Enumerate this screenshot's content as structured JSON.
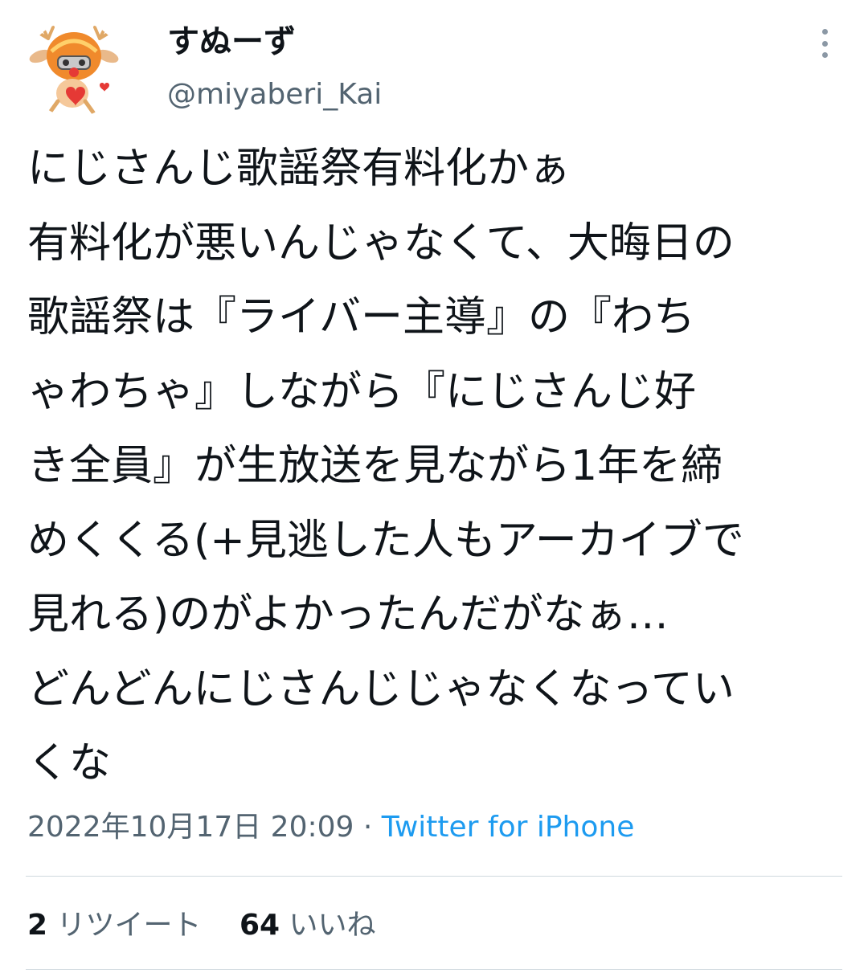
{
  "user": {
    "display_name": "すぬーず",
    "handle": "@miyaberi_Kai",
    "avatar_icon": "deer-character-avatar-icon"
  },
  "menu": {
    "icon": "more-vertical-icon"
  },
  "tweet": {
    "lines": [
      "にじさんじ歌謡祭有料化かぁ",
      "有料化が悪いんじゃなくて、大晦日の",
      "歌謡祭は『ライバー主導』の『わち",
      "ゃわちゃ』しながら『にじさんじ好",
      "き全員』が生放送を見ながら1年を締",
      "めくくる(+見逃した人もアーカイブで",
      "見れる)のがよかったんだがなぁ…",
      "どんどんにじさんじじゃなくなってい",
      "くな"
    ]
  },
  "meta": {
    "timestamp": "2022年10月17日 20:09",
    "separator": "·",
    "source": "Twitter for iPhone"
  },
  "stats": {
    "retweets_count": "2",
    "retweets_label": "リツイート",
    "likes_count": "64",
    "likes_label": "いいね"
  },
  "colors": {
    "text": "#0f1419",
    "secondary": "#536471",
    "link": "#1d9bf0",
    "divider": "#cfd9de"
  }
}
